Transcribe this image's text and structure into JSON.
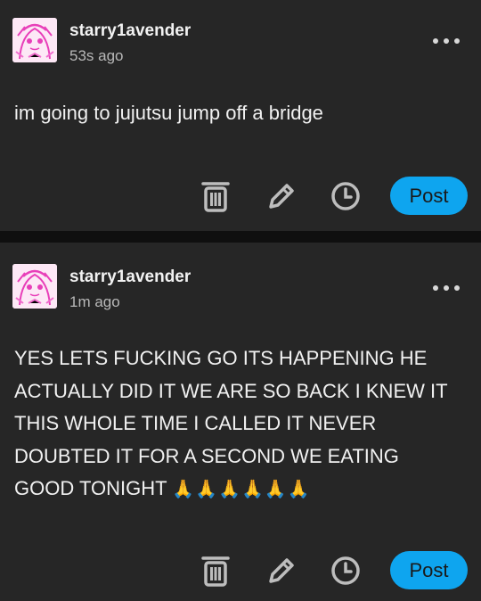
{
  "posts": [
    {
      "username": "starry1avender",
      "timestamp": "53s ago",
      "text": "im going to jujutsu jump off a bridge",
      "emoji": "",
      "post_label": "Post"
    },
    {
      "username": "starry1avender",
      "timestamp": "1m ago",
      "text": "YES LETS FUCKING GO ITS HAPPENING HE ACTUALLY DID IT WE ARE SO BACK I KNEW IT THIS WHOLE TIME I CALLED IT NEVER DOUBTED IT FOR A SECOND WE EATING GOOD TONIGHT",
      "emoji": "🙏🙏🙏🙏🙏🙏",
      "post_label": "Post"
    }
  ],
  "icons": {
    "more": "more-horizontal-icon",
    "trash": "trash-icon",
    "edit": "pencil-icon",
    "schedule": "clock-icon"
  },
  "colors": {
    "background": "#262626",
    "separator": "#0f0f0f",
    "accent": "#0ea5ef",
    "avatar_pink": "#e83fb9"
  }
}
